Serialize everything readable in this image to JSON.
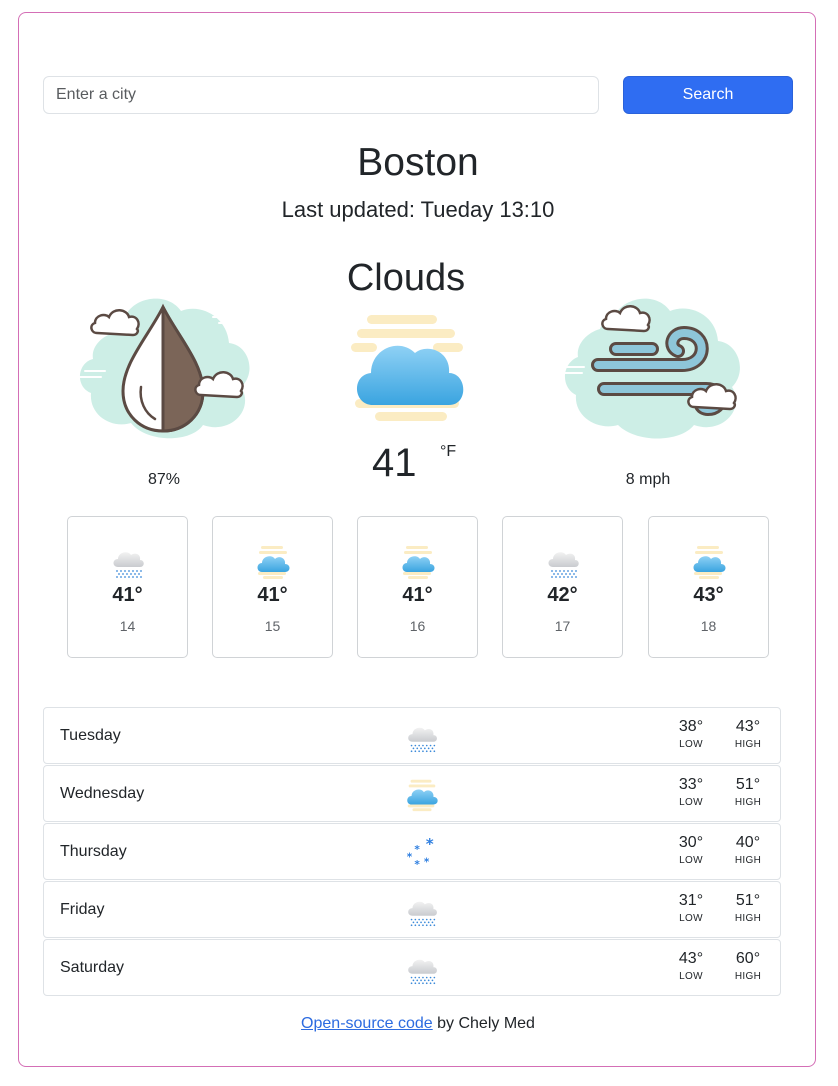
{
  "search": {
    "placeholder": "Enter a city",
    "button_label": "Search"
  },
  "current": {
    "city": "Boston",
    "last_updated": "Last updated: Tueday 13:10",
    "description": "Clouds",
    "temperature": "41",
    "unit": "°F",
    "humidity": "87%",
    "wind": "8 mph",
    "humidity_icon": "humidity-drop-icon",
    "main_icon": "clouds-icon",
    "wind_icon": "wind-icon"
  },
  "hourly": [
    {
      "temp": "41°",
      "hour": "14",
      "icon": "rain-icon"
    },
    {
      "temp": "41°",
      "hour": "15",
      "icon": "clouds-icon"
    },
    {
      "temp": "41°",
      "hour": "16",
      "icon": "clouds-icon"
    },
    {
      "temp": "42°",
      "hour": "17",
      "icon": "rain-icon"
    },
    {
      "temp": "43°",
      "hour": "18",
      "icon": "clouds-icon"
    }
  ],
  "daily": [
    {
      "day": "Tuesday",
      "low": "38°",
      "high": "43°",
      "icon": "rain-icon"
    },
    {
      "day": "Wednesday",
      "low": "33°",
      "high": "51°",
      "icon": "clouds-icon"
    },
    {
      "day": "Thursday",
      "low": "30°",
      "high": "40°",
      "icon": "snow-icon"
    },
    {
      "day": "Friday",
      "low": "31°",
      "high": "51°",
      "icon": "rain-icon"
    },
    {
      "day": "Saturday",
      "low": "43°",
      "high": "60°",
      "icon": "rain-icon"
    }
  ],
  "labels": {
    "low": "LOW",
    "high": "HIGH"
  },
  "footer": {
    "link_text": "Open-source code",
    "suffix": " by Chely Med"
  },
  "colors": {
    "accent": "#2f6df2",
    "border": "#d46fb6",
    "link": "#2c6be0"
  }
}
